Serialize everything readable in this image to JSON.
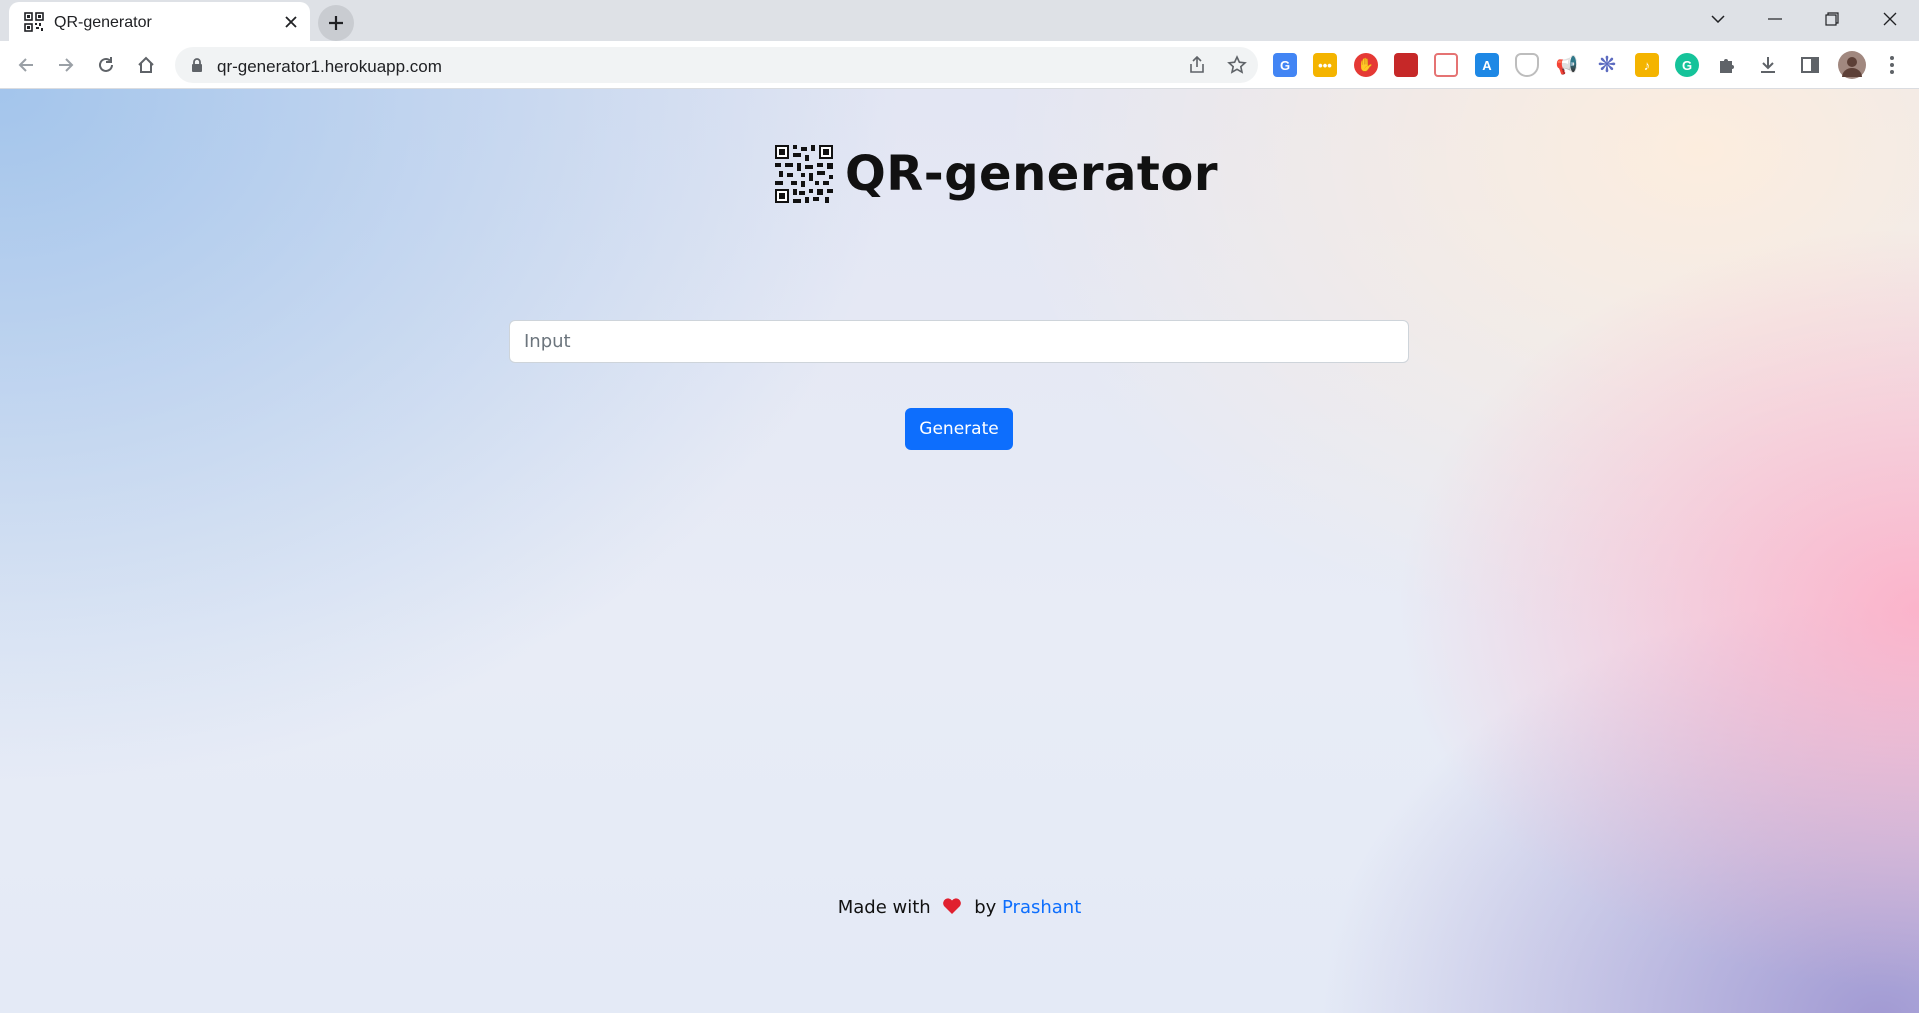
{
  "browser": {
    "tab": {
      "title": "QR-generator",
      "favicon": "qr-code-icon"
    },
    "url": "qr-generator1.herokuapp.com",
    "extensions": [
      {
        "name": "translate-extension-icon",
        "color": "#4285f4"
      },
      {
        "name": "notes-extension-icon",
        "color": "#f4b400"
      },
      {
        "name": "adblock-extension-icon",
        "color": "#e53935"
      },
      {
        "name": "bookmark-extension-icon",
        "color": "#c62828"
      },
      {
        "name": "screenshot-extension-icon",
        "color": "#e57373"
      },
      {
        "name": "dictionary-extension-icon",
        "color": "#1e88e5"
      },
      {
        "name": "shield-extension-icon",
        "color": "#9e9e9e"
      },
      {
        "name": "megaphone-extension-icon",
        "color": "#e53935"
      },
      {
        "name": "sparkle-extension-icon",
        "color": "#5c6bc0"
      },
      {
        "name": "audio-extension-icon",
        "color": "#f4b400"
      },
      {
        "name": "grammarly-extension-icon",
        "color": "#15c39a"
      }
    ]
  },
  "page": {
    "title": "QR-generator",
    "input": {
      "placeholder": "Input",
      "value": ""
    },
    "generate_label": "Generate",
    "footer": {
      "made_with": "Made with",
      "by": "by",
      "author": "Prashant"
    },
    "colors": {
      "accent": "#0d6efd",
      "heart": "#e0202f"
    }
  }
}
